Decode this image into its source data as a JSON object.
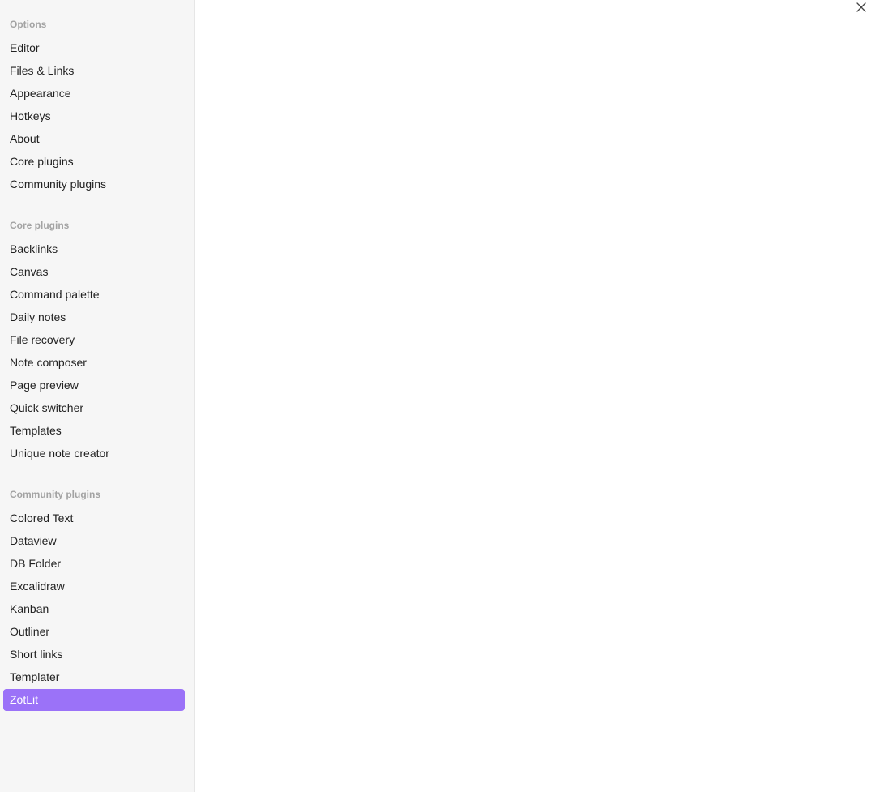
{
  "sidebar": {
    "groups": [
      {
        "title": "Options",
        "items": [
          {
            "label": "Editor"
          },
          {
            "label": "Files & Links"
          },
          {
            "label": "Appearance"
          },
          {
            "label": "Hotkeys"
          },
          {
            "label": "About"
          },
          {
            "label": "Core plugins"
          },
          {
            "label": "Community plugins"
          }
        ]
      },
      {
        "title": "Core plugins",
        "items": [
          {
            "label": "Backlinks"
          },
          {
            "label": "Canvas"
          },
          {
            "label": "Command palette"
          },
          {
            "label": "Daily notes"
          },
          {
            "label": "File recovery"
          },
          {
            "label": "Note composer"
          },
          {
            "label": "Page preview"
          },
          {
            "label": "Quick switcher"
          },
          {
            "label": "Templates"
          },
          {
            "label": "Unique note creator"
          }
        ]
      },
      {
        "title": "Community plugins",
        "items": [
          {
            "label": "Colored Text"
          },
          {
            "label": "Dataview"
          },
          {
            "label": "DB Folder"
          },
          {
            "label": "Excalidraw"
          },
          {
            "label": "Kanban"
          },
          {
            "label": "Outliner"
          },
          {
            "label": "Short links"
          },
          {
            "label": "Templater"
          },
          {
            "label": "ZotLit",
            "active": true
          }
        ]
      }
    ]
  },
  "window": {
    "close_icon": "close-icon"
  },
  "colors": {
    "accent": "#9b72f8",
    "sidebar_bg": "#f6f6f6",
    "group_title": "#a3a3a3"
  }
}
